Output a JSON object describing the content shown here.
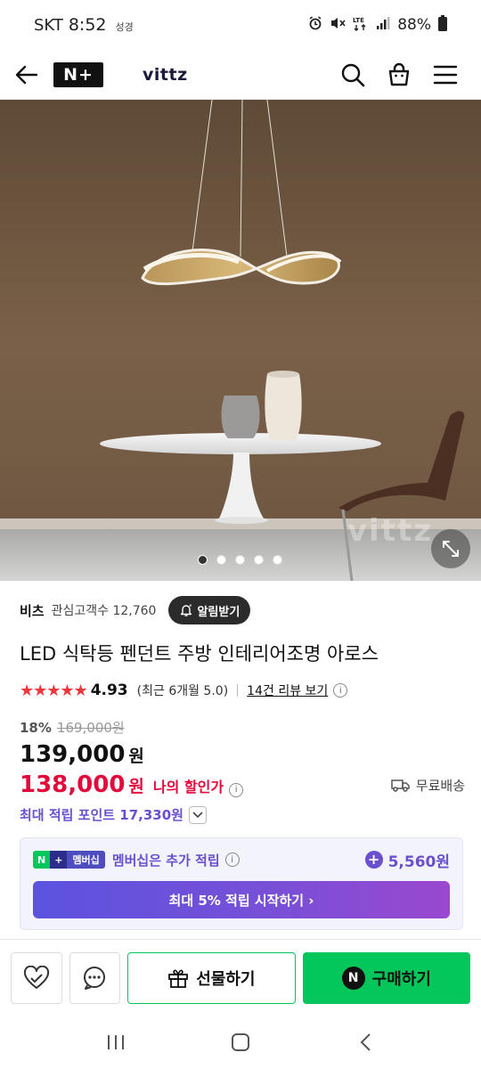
{
  "status": {
    "carrier": "SKT",
    "time": "8:52",
    "extra": "성경",
    "battery": "88%",
    "icons": [
      "alarm-icon",
      "mute-icon",
      "lte-icon",
      "signal-icon",
      "battery-icon"
    ]
  },
  "header": {
    "brand_logo": "N+",
    "store_name": "vittz",
    "icons": [
      "back-arrow-icon",
      "search-icon",
      "cart-icon",
      "menu-icon"
    ]
  },
  "hero": {
    "watermark": "vittz",
    "slide_count": 5,
    "active_slide": 1
  },
  "store": {
    "label": "비츠",
    "followers": "관심고객수 12,760",
    "alarm_label": "알림받기"
  },
  "product": {
    "title": "LED 식탁등 펜던트 주방 인테리어조명 아로스",
    "stars": "★★★★★",
    "rating": "4.93",
    "rating_recent": "(최근 6개월 5.0)",
    "review_link": "14건 리뷰 보기",
    "discount_pct": "18%",
    "original_price": "169,000원",
    "sale_price": "139,000",
    "won": "원",
    "my_price": "138,000",
    "my_won": "원",
    "my_price_label": "나의 할인가",
    "shipping": "무료배송",
    "points": "최대 적립 포인트 17,330원"
  },
  "membership": {
    "badge_n": "N",
    "badge_plus": "+",
    "badge_text": "멤버십",
    "text": "멤버십은 추가 적립",
    "amount": "5,560원",
    "cta": "최대 5% 적립 시작하기 ›"
  },
  "actions": {
    "gift_label": "선물하기",
    "buy_label": "구매하기",
    "buy_badge": "N"
  },
  "colors": {
    "accent_green": "#03c75a",
    "price_red": "#e3093b",
    "points_purple": "#6a4fd0",
    "star_red": "#f1363b"
  }
}
